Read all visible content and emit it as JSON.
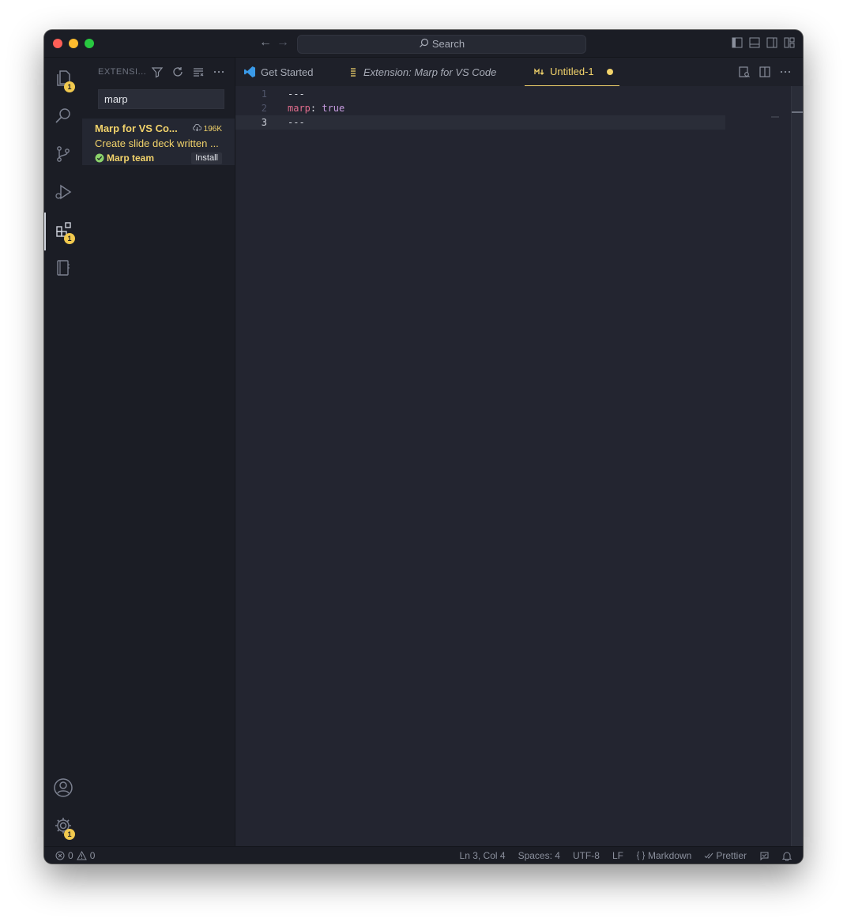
{
  "titlebar": {
    "search_label": "Search"
  },
  "activity_bar": {
    "explorer_badge": "1",
    "extensions_badge": "1",
    "settings_badge": "1"
  },
  "sidebar": {
    "title": "EXTENSI...",
    "search_value": "marp",
    "extension": {
      "name": "Marp for VS Co...",
      "downloads": "196K",
      "description": "Create slide deck written ...",
      "publisher": "Marp team",
      "install_label": "Install"
    }
  },
  "tabs": [
    {
      "label": "Get Started"
    },
    {
      "label": "Extension: Marp for VS Code"
    },
    {
      "label": "Untitled-1"
    }
  ],
  "editor": {
    "lines": [
      {
        "num": "1",
        "text": "---"
      },
      {
        "num": "2",
        "key": "marp",
        "sep": ": ",
        "value": "true"
      },
      {
        "num": "3",
        "text": "---"
      }
    ]
  },
  "statusbar": {
    "errors": "0",
    "warnings": "0",
    "position": "Ln 3, Col 4",
    "spaces": "Spaces: 4",
    "encoding": "UTF-8",
    "eol": "LF",
    "language": "Markdown",
    "formatter": "Prettier"
  },
  "colors": {
    "accent": "#f2d36b",
    "badge": "#f1c94e",
    "editor_bg": "#232530",
    "sidebar_bg": "#1b1d25"
  }
}
